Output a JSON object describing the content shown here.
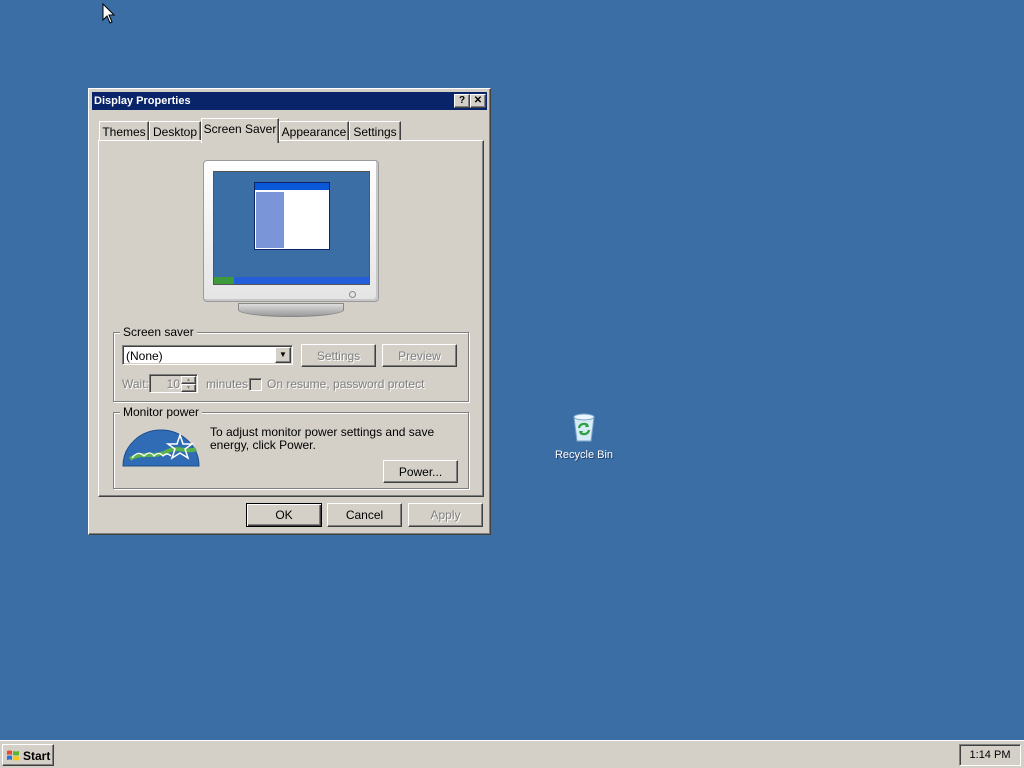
{
  "window": {
    "title": "Display Properties",
    "help_button": "?",
    "close_button": "✕"
  },
  "tabs": [
    {
      "label": "Themes",
      "active": false
    },
    {
      "label": "Desktop",
      "active": false
    },
    {
      "label": "Screen Saver",
      "active": true
    },
    {
      "label": "Appearance",
      "active": false
    },
    {
      "label": "Settings",
      "active": false
    }
  ],
  "screen_saver": {
    "group_label": "Screen saver",
    "selected": "(None)",
    "settings_button": "Settings",
    "preview_button": "Preview",
    "wait_label": "Wait:",
    "wait_value": "10",
    "minutes_label": "minutes",
    "password_label": "On resume, password protect",
    "password_checked": false
  },
  "monitor_power": {
    "group_label": "Monitor power",
    "description": "To adjust monitor power settings and save energy, click Power.",
    "power_button": "Power...",
    "logo_icon": "energy-star-icon"
  },
  "dialog_buttons": {
    "ok": "OK",
    "cancel": "Cancel",
    "apply": "Apply"
  },
  "desktop": {
    "background_color": "#3b6ea5",
    "icons": [
      {
        "label": "Recycle Bin",
        "icon": "recycle-bin-icon"
      }
    ]
  },
  "taskbar": {
    "start_label": "Start",
    "clock": "1:14 PM"
  },
  "colors": {
    "title_bar": "#0a246a",
    "face": "#d4d0c8"
  }
}
